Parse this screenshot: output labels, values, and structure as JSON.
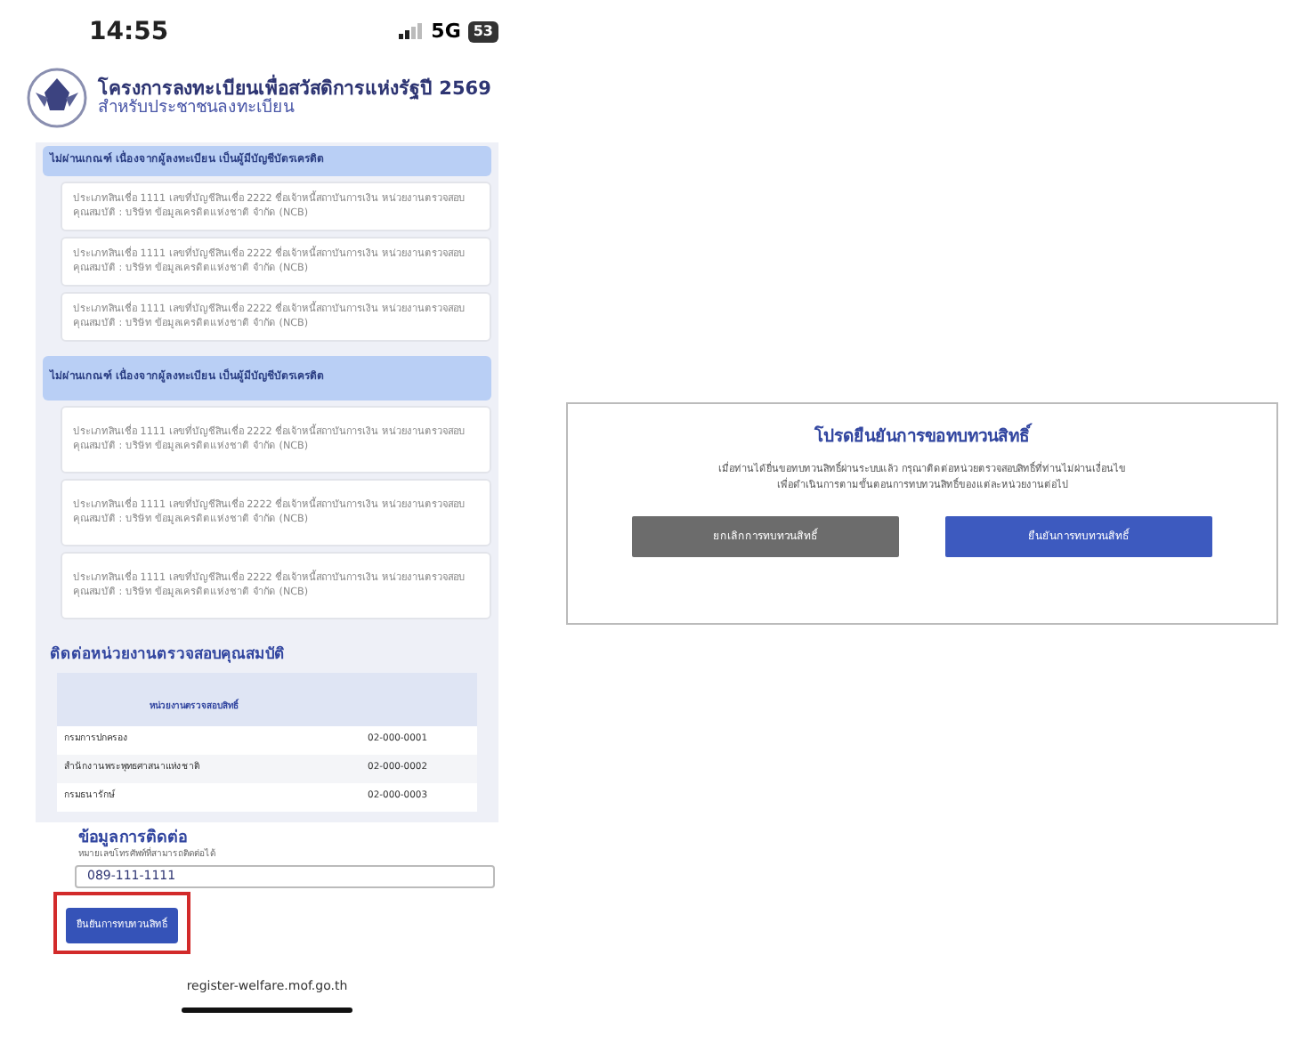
{
  "status_bar": {
    "time": "14:55",
    "network": "5G",
    "battery": "53"
  },
  "header": {
    "title": "โครงการลงทะเบียนเพื่อสวัสดิการแห่งรัฐปี 2569",
    "subtitle": "สำหรับประชาชนลงทะเบียน"
  },
  "sections": [
    {
      "title": "ไม่ผ่านเกณฑ์ เนื่องจากผู้ลงทะเบียน เป็นผู้มีบัญชีบัตรเครดิต",
      "items": [
        "ประเภทสินเชื่อ 1111 เลขที่บัญชีสินเชื่อ 2222 ชื่อเจ้าหนี้สถาบันการเงิน หน่วยงานตรวจสอบคุณสมบัติ : บริษัท ข้อมูลเครดิตแห่งชาติ จำกัด (NCB)",
        "ประเภทสินเชื่อ 1111 เลขที่บัญชีสินเชื่อ 2222 ชื่อเจ้าหนี้สถาบันการเงิน หน่วยงานตรวจสอบคุณสมบัติ : บริษัท ข้อมูลเครดิตแห่งชาติ จำกัด (NCB)",
        "ประเภทสินเชื่อ 1111 เลขที่บัญชีสินเชื่อ 2222 ชื่อเจ้าหนี้สถาบันการเงิน หน่วยงานตรวจสอบคุณสมบัติ : บริษัท ข้อมูลเครดิตแห่งชาติ จำกัด (NCB)"
      ]
    },
    {
      "title": "ไม่ผ่านเกณฑ์ เนื่องจากผู้ลงทะเบียน เป็นผู้มีบัญชีบัตรเครดิต",
      "items": [
        "ประเภทสินเชื่อ 1111 เลขที่บัญชีสินเชื่อ 2222 ชื่อเจ้าหนี้สถาบันการเงิน หน่วยงานตรวจสอบคุณสมบัติ : บริษัท ข้อมูลเครดิตแห่งชาติ จำกัด (NCB)",
        "ประเภทสินเชื่อ 1111 เลขที่บัญชีสินเชื่อ 2222 ชื่อเจ้าหนี้สถาบันการเงิน หน่วยงานตรวจสอบคุณสมบัติ : บริษัท ข้อมูลเครดิตแห่งชาติ จำกัด (NCB)",
        "ประเภทสินเชื่อ 1111 เลขที่บัญชีสินเชื่อ 2222 ชื่อเจ้าหนี้สถาบันการเงิน หน่วยงานตรวจสอบคุณสมบัติ : บริษัท ข้อมูลเครดิตแห่งชาติ จำกัด (NCB)"
      ]
    }
  ],
  "contact": {
    "title": "ติดต่อหน่วยงานตรวจสอบคุณสมบัติ",
    "table": {
      "columns": [
        "หน่วยงานตรวจสอบสิทธิ์"
      ],
      "rows": [
        [
          "กรมการปกครอง",
          "02-000-0001"
        ],
        [
          "สำนักงานพระพุทธศาสนาแห่งชาติ",
          "02-000-0002"
        ],
        [
          "กรมธนารักษ์",
          "02-000-0003"
        ]
      ]
    }
  },
  "contact_info": {
    "title": "ข้อมูลการติดต่อ",
    "phone_label": "หมายเลขโทรศัพท์ที่สามารถติดต่อได้",
    "phone_value": "089-111-1111",
    "button": {
      "label": "ยืนยันการทบทวนสิทธิ์",
      "highlighted": true
    }
  },
  "url": "register-welfare.mof.go.th",
  "dialog": {
    "title": "โปรดยืนยันการขอทบทวนสิทธิ์",
    "message": "เมื่อท่านได้ยื่นขอทบทวนสิทธิ์ผ่านระบบแล้ว กรุณาติดต่อหน่วยตรวจสอบสิทธิ์ที่ท่านไม่ผ่านเงื่อนไข เพื่อดำเนินการตามขั้นตอนการทบทวนสิทธิ์ของแต่ละหน่วยงานต่อไป",
    "buttons": [
      {
        "label": "ยกเลิกการทบทวนสิทธิ์",
        "kind": "cancel"
      },
      {
        "label": "ยืนยันการทบทวนสิทธิ์",
        "kind": "confirm"
      }
    ]
  }
}
